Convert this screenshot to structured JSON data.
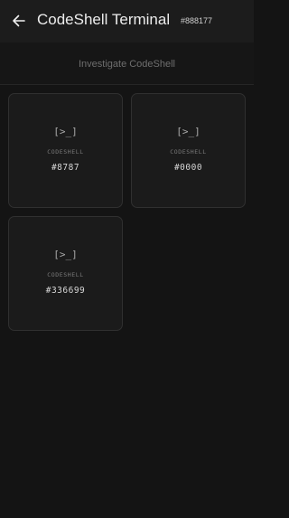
{
  "header": {
    "title": "CodeShell Terminal",
    "session_code": "#888177"
  },
  "subheader": {
    "text": "Investigate CodeShell"
  },
  "tiles": [
    {
      "glyph": "[>_]",
      "label": "CODESHELL",
      "code": "#8787"
    },
    {
      "glyph": "[>_]",
      "label": "CODESHELL",
      "code": "#0000"
    },
    {
      "glyph": "[>_]",
      "label": "CODESHELL",
      "code": "#336699"
    }
  ],
  "icons": {
    "back": "arrow-left-icon"
  },
  "colors": {
    "background": "#141414",
    "topbar": "#1c1c1c",
    "tile": "#1b1b1b",
    "tile_border": "#303030",
    "text_primary": "#ececec",
    "text_muted": "#6e6e6e"
  }
}
